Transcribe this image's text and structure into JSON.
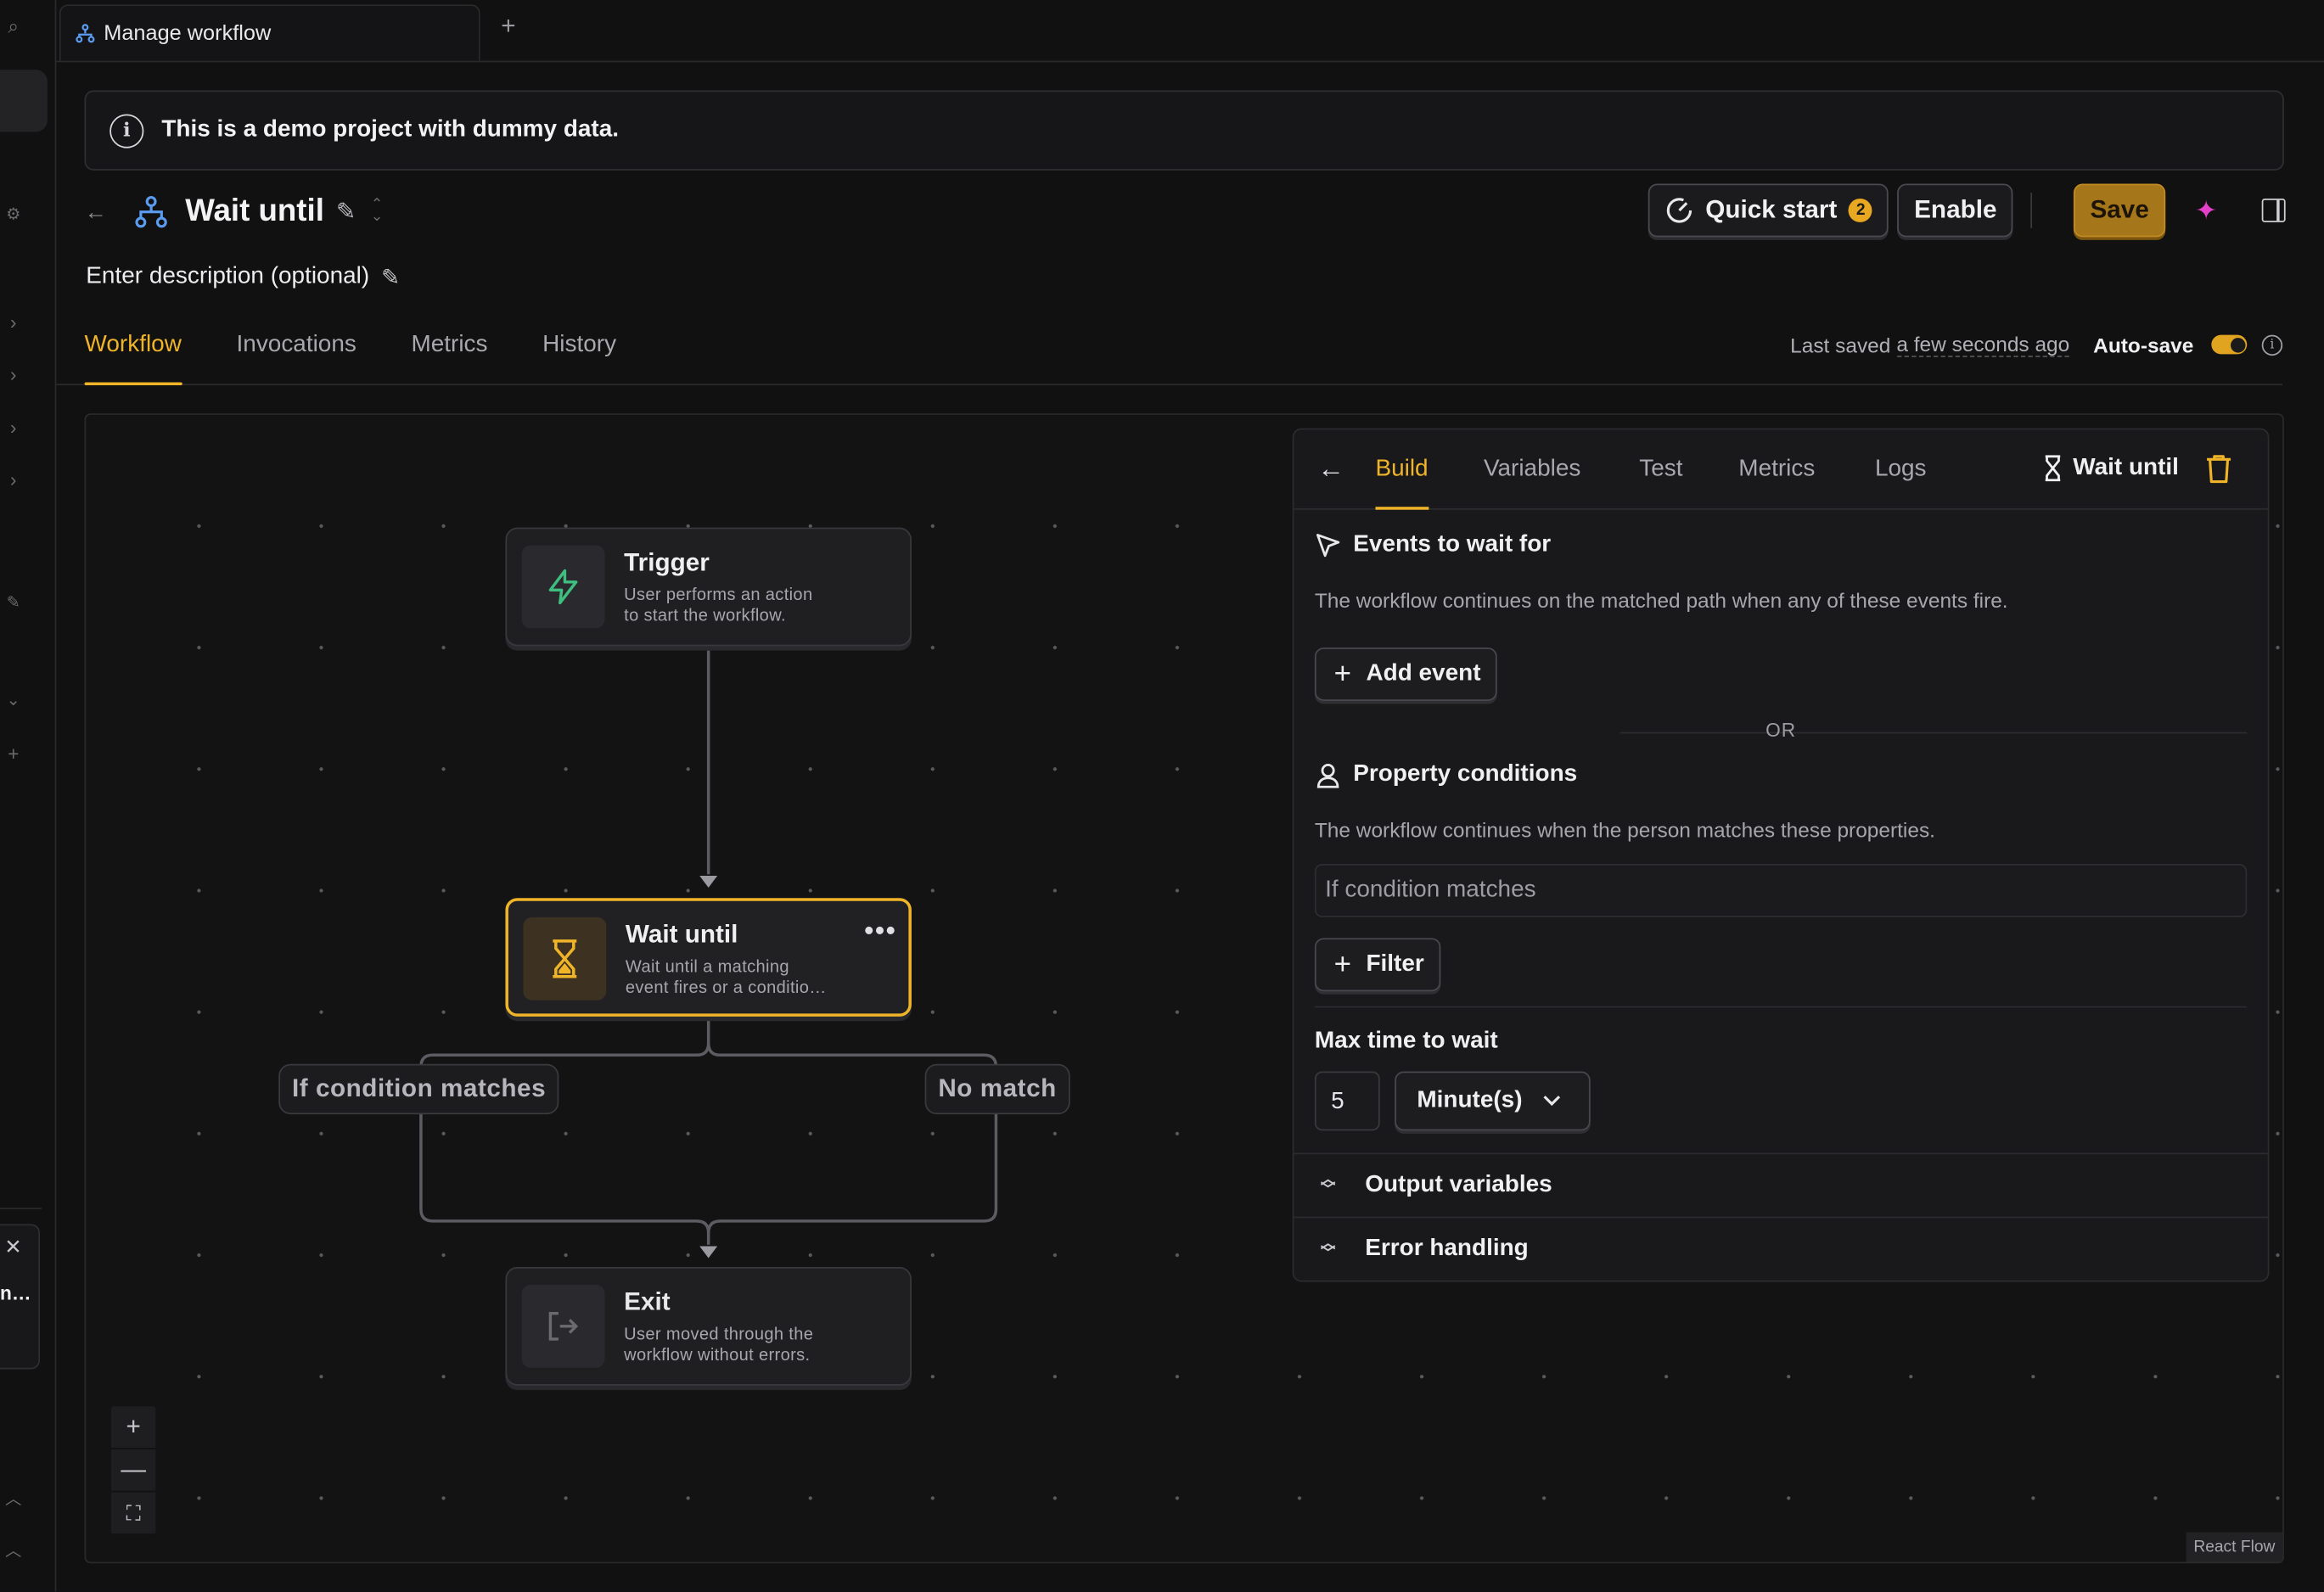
{
  "tab": {
    "title": "Manage workflow",
    "add": "+"
  },
  "banner": {
    "text": "This is a demo project with dummy data.",
    "icon": "info-icon"
  },
  "header": {
    "title": "Wait until",
    "description": "Enter description (optional)",
    "quick_start_label": "Quick start",
    "quick_start_count": "2",
    "enable_label": "Enable",
    "save_label": "Save"
  },
  "main_tabs": [
    {
      "label": "Workflow",
      "active": true
    },
    {
      "label": "Invocations",
      "active": false
    },
    {
      "label": "Metrics",
      "active": false
    },
    {
      "label": "History",
      "active": false
    }
  ],
  "save_status": {
    "prefix": "Last saved",
    "ago": "a few seconds ago",
    "autosave_label": "Auto-save",
    "autosave_on": true
  },
  "nodes": {
    "trigger": {
      "title": "Trigger",
      "desc1": "User performs an action",
      "desc2": "to start the workflow."
    },
    "wait": {
      "title": "Wait until",
      "desc1": "Wait until a matching",
      "desc2": "event fires or a conditio…",
      "menu": "•••"
    },
    "exit": {
      "title": "Exit",
      "desc1": "User moved through the",
      "desc2": "workflow without errors."
    }
  },
  "edges": {
    "match": "If condition matches",
    "nomatch": "No match"
  },
  "zoom": {
    "in": "+",
    "out": "—",
    "fit": "⛶"
  },
  "attribution": "React Flow",
  "panel": {
    "tabs": [
      {
        "label": "Build",
        "active": true
      },
      {
        "label": "Variables",
        "active": false
      },
      {
        "label": "Test",
        "active": false
      },
      {
        "label": "Metrics",
        "active": false
      },
      {
        "label": "Logs",
        "active": false
      }
    ],
    "step_name": "Wait until",
    "events_title": "Events to wait for",
    "events_desc": "The workflow continues on the matched path when any of these events fire.",
    "add_event_label": "Add event",
    "or_label": "OR",
    "props_title": "Property conditions",
    "props_desc": "The workflow continues when the person matches these properties.",
    "cond_text": "If condition matches",
    "filter_label": "Filter",
    "max_wait_title": "Max time to wait",
    "max_wait_value": "5",
    "max_wait_unit": "Minute(s)",
    "output_vars": "Output variables",
    "error_handling": "Error handling"
  },
  "colors": {
    "accent": "#f0b429",
    "save_bg": "#a6761a",
    "trigger_icon": "#3fbf7f",
    "sparkle": "#e640c8"
  }
}
